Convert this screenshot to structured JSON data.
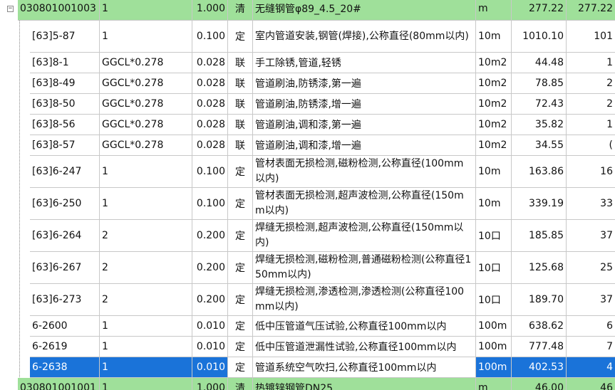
{
  "rows": [
    {
      "kind": "group",
      "code": "030801001003",
      "qty_exp": "1",
      "qty": "1.000",
      "type": "清",
      "name": "无缝钢管φ89_4.5_20#",
      "unit": "m",
      "price": "277.22",
      "total": "277.22"
    },
    {
      "kind": "item",
      "code": "[63]5-87",
      "qty_exp": "1",
      "qty": "0.100",
      "type": "定",
      "name": "室内管道安装,钢管(焊接),公称直径(80mm以内)",
      "unit": "10m",
      "price": "1010.10",
      "total": "101",
      "tall": true
    },
    {
      "kind": "item",
      "code": "[63]8-1",
      "qty_exp": "GGCL*0.278",
      "qty": "0.028",
      "type": "联",
      "name": "手工除锈,管道,轻锈",
      "unit": "10m2",
      "price": "44.48",
      "total": "1"
    },
    {
      "kind": "item",
      "code": "[63]8-49",
      "qty_exp": "GGCL*0.278",
      "qty": "0.028",
      "type": "联",
      "name": "管道刷油,防锈漆,第一遍",
      "unit": "10m2",
      "price": "78.85",
      "total": "2"
    },
    {
      "kind": "item",
      "code": "[63]8-50",
      "qty_exp": "GGCL*0.278",
      "qty": "0.028",
      "type": "联",
      "name": "管道刷油,防锈漆,增一遍",
      "unit": "10m2",
      "price": "72.43",
      "total": "2"
    },
    {
      "kind": "item",
      "code": "[63]8-56",
      "qty_exp": "GGCL*0.278",
      "qty": "0.028",
      "type": "联",
      "name": "管道刷油,调和漆,第一遍",
      "unit": "10m2",
      "price": "35.82",
      "total": "1"
    },
    {
      "kind": "item",
      "code": "[63]8-57",
      "qty_exp": "GGCL*0.278",
      "qty": "0.028",
      "type": "联",
      "name": "管道刷油,调和漆,增一遍",
      "unit": "10m2",
      "price": "34.55",
      "total": "("
    },
    {
      "kind": "item",
      "code": "[63]6-247",
      "qty_exp": "1",
      "qty": "0.100",
      "type": "定",
      "name": "管材表面无损检测,磁粉检测,公称直径(100mm以内)",
      "unit": "10m",
      "price": "163.86",
      "total": "16",
      "tall": true
    },
    {
      "kind": "item",
      "code": "[63]6-250",
      "qty_exp": "1",
      "qty": "0.100",
      "type": "定",
      "name": "管材表面无损检测,超声波检测,公称直径(150mm以内)",
      "unit": "10m",
      "price": "339.19",
      "total": "33",
      "tall": true
    },
    {
      "kind": "item",
      "code": "[63]6-264",
      "qty_exp": "2",
      "qty": "0.200",
      "type": "定",
      "name": "焊缝无损检测,超声波检测,公称直径(150mm以内)",
      "unit": "10口",
      "price": "185.85",
      "total": "37",
      "tall": true
    },
    {
      "kind": "item",
      "code": "[63]6-267",
      "qty_exp": "2",
      "qty": "0.200",
      "type": "定",
      "name": "焊缝无损检测,磁粉检测,普通磁粉检测(公称直径150mm以内)",
      "unit": "10口",
      "price": "125.68",
      "total": "25",
      "tall": true
    },
    {
      "kind": "item",
      "code": "[63]6-273",
      "qty_exp": "2",
      "qty": "0.200",
      "type": "定",
      "name": "焊缝无损检测,渗透检测,渗透检测(公称直径100mm以内)",
      "unit": "10口",
      "price": "189.70",
      "total": "37",
      "tall": true
    },
    {
      "kind": "item",
      "code": "6-2600",
      "qty_exp": "1",
      "qty": "0.010",
      "type": "定",
      "name": "低中压管道气压试验,公称直径100mm以内",
      "unit": "100m",
      "price": "638.62",
      "total": "6"
    },
    {
      "kind": "item",
      "code": "6-2619",
      "qty_exp": "1",
      "qty": "0.010",
      "type": "定",
      "name": "低中压管道泄漏性试验,公称直径100mm以内",
      "unit": "100m",
      "price": "777.48",
      "total": "7"
    },
    {
      "kind": "sel",
      "code": "6-2638",
      "qty_exp": "1",
      "qty": "0.010",
      "type": "定",
      "name": "管道系统空气吹扫,公称直径100mm以内",
      "unit": "100m",
      "price": "402.53",
      "total": "4"
    },
    {
      "kind": "group",
      "code": "030801001001",
      "qty_exp": "1",
      "qty": "1.000",
      "type": "清",
      "name": "热镀锌钢管DN25",
      "unit": "m",
      "price": "46.00",
      "total": "46"
    }
  ],
  "colors": {
    "group_bg": "#9fe09a",
    "selected_bg": "#1a73d9"
  }
}
